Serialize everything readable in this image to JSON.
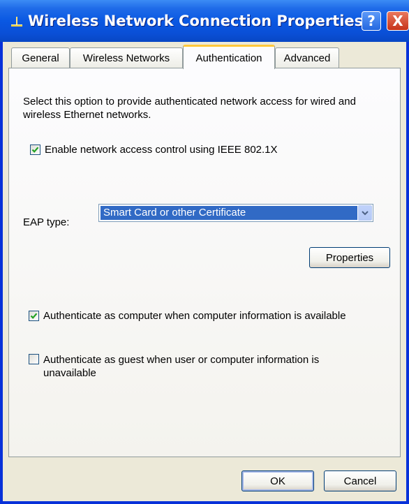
{
  "window": {
    "title": "Wireless Network Connection Properties",
    "help_label": "?",
    "close_label": "X"
  },
  "tabs": [
    {
      "label": "General",
      "active": false
    },
    {
      "label": "Wireless Networks",
      "active": false
    },
    {
      "label": "Authentication",
      "active": true
    },
    {
      "label": "Advanced",
      "active": false
    }
  ],
  "authentication": {
    "description": "Select this option to provide authenticated network access for wired and wireless Ethernet networks.",
    "enable_8021x": {
      "label": "Enable network access control using IEEE 802.1X",
      "checked": true
    },
    "eap_type_label": "EAP type:",
    "eap_type_value": "Smart Card or other Certificate",
    "properties_label": "Properties",
    "auth_as_computer": {
      "label": "Authenticate as computer when computer information is available",
      "checked": true
    },
    "auth_as_guest": {
      "label": "Authenticate as guest when user or computer information is unavailable",
      "checked": false
    }
  },
  "footer": {
    "ok_label": "OK",
    "cancel_label": "Cancel"
  },
  "colors": {
    "titlebar": "#0a58e2",
    "dialog_face": "#ece9d8",
    "selection": "#316ac5",
    "active_tab_accent": "#ffc83c",
    "checkmark": "#21a121"
  },
  "icons": {
    "title_icon": "network-connection-icon",
    "help": "help-icon",
    "close": "close-icon",
    "dropdown": "chevron-down-icon",
    "check": "checkmark-icon"
  }
}
